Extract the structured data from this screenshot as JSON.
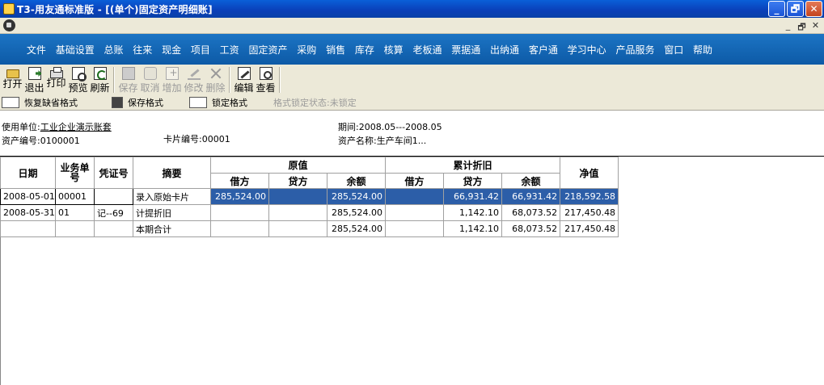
{
  "window": {
    "title": "T3-用友通标准版 - [(单个)固定资产明细账]",
    "buttons": {
      "minimize": "_",
      "maximize": "🗗",
      "close": "✕"
    },
    "mdi_buttons": {
      "minimize": "_",
      "restore": "🗗",
      "close": "✕"
    }
  },
  "menu": [
    "文件",
    "基础设置",
    "总账",
    "往来",
    "现金",
    "项目",
    "工资",
    "固定资产",
    "采购",
    "销售",
    "库存",
    "核算",
    "老板通",
    "票据通",
    "出纳通",
    "客户通",
    "学习中心",
    "产品服务",
    "窗口",
    "帮助"
  ],
  "toolbar": {
    "open": "打开",
    "exit": "退出",
    "print": "打印",
    "preview": "预览",
    "refresh": "刷新",
    "save": "保存",
    "cancel": "取消",
    "add": "增加",
    "modify": "修改",
    "delete": "删除",
    "edit": "编辑",
    "view": "查看"
  },
  "formatbar": {
    "restore_default": "恢复缺省格式",
    "save_format": "保存格式",
    "lock_format": "锁定格式",
    "lock_status": "格式锁定状态:未锁定"
  },
  "info": {
    "unit_label": "使用单位:",
    "unit_value": "工业企业演示账套",
    "period": "期间:2008.05---2008.05",
    "asset_no": "资产编号:0100001",
    "card_no": "卡片编号:00001",
    "asset_name": "资产名称:生产车间1..."
  },
  "table": {
    "headers": {
      "date": "日期",
      "biz_no": "业务单号",
      "voucher_no": "凭证号",
      "summary": "摘要",
      "original": "原值",
      "accum_dep": "累计折旧",
      "net": "净值",
      "debit": "借方",
      "credit": "贷方",
      "balance": "余额"
    },
    "rows": [
      {
        "date": "2008-05-01",
        "biz_no": "00001",
        "voucher": "",
        "summary": "录入原始卡片",
        "orig_debit": "285,524.00",
        "orig_credit": "",
        "orig_balance": "285,524.00",
        "dep_debit": "",
        "dep_credit": "66,931.42",
        "dep_balance": "66,931.42",
        "net": "218,592.58"
      },
      {
        "date": "2008-05-31",
        "biz_no": "01",
        "voucher": "记--69",
        "summary": "计提折旧",
        "orig_debit": "",
        "orig_credit": "",
        "orig_balance": "285,524.00",
        "dep_debit": "",
        "dep_credit": "1,142.10",
        "dep_balance": "68,073.52",
        "net": "217,450.48"
      },
      {
        "date": "",
        "biz_no": "",
        "voucher": "",
        "summary": "本期合计",
        "orig_debit": "",
        "orig_credit": "",
        "orig_balance": "285,524.00",
        "dep_debit": "",
        "dep_credit": "1,142.10",
        "dep_balance": "68,073.52",
        "net": "217,450.48"
      }
    ]
  }
}
